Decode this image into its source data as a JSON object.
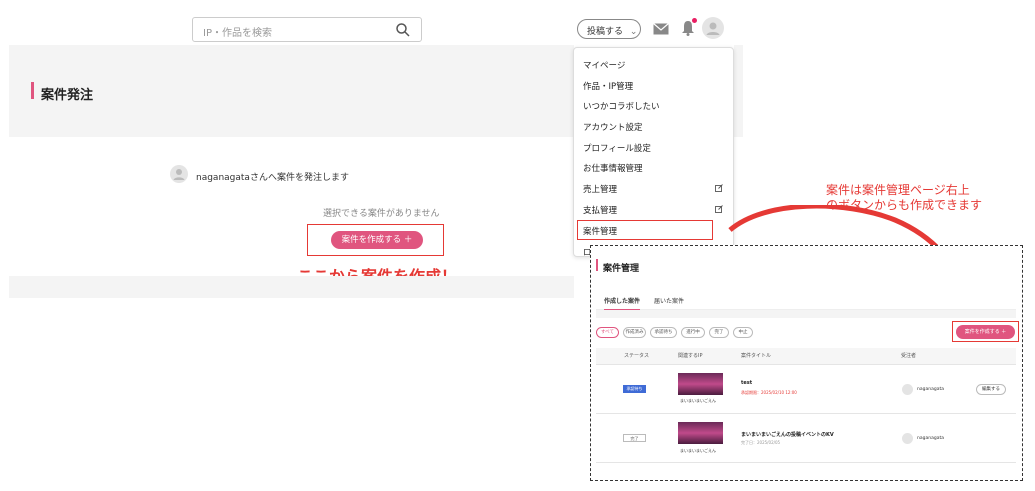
{
  "header": {
    "search_placeholder": "IP・作品を検索",
    "post_button": "投稿する",
    "accent_color": "#e0557f"
  },
  "page": {
    "title": "案件発注",
    "user_message": "naganagataさんへ案件を発注します",
    "empty_message": "選択できる案件がありません",
    "create_button": "案件を作成する ＋",
    "callout_main": "ここから案件を作成！"
  },
  "dropdown": {
    "items": [
      {
        "label": "マイページ"
      },
      {
        "label": "作品・IP管理"
      },
      {
        "label": "いつかコラボしたい"
      },
      {
        "label": "アカウント設定"
      },
      {
        "label": "プロフィール設定"
      },
      {
        "label": "お仕事情報管理"
      },
      {
        "label": "売上管理",
        "external": true
      },
      {
        "label": "支払管理",
        "external": true
      },
      {
        "label": "案件管理"
      },
      {
        "label": "ロ"
      }
    ]
  },
  "callout_side": {
    "line1": "案件は案件管理ページ右上",
    "line2": "のボタンからも作成できます"
  },
  "inset": {
    "title": "案件管理",
    "tabs": [
      "作成した案件",
      "届いた案件"
    ],
    "filters": [
      "すべて",
      "作成済み",
      "承認待ち",
      "進行中",
      "完了",
      "中止"
    ],
    "create_button": "案件を作成する ＋",
    "columns": [
      "ステータス",
      "関連するIP",
      "案件タイトル",
      "受注者"
    ],
    "rows": [
      {
        "status": "承認待ち",
        "ip_caption": "まいまいまいごえん",
        "title": "test",
        "sub": "承認期限：2025/02/10 12:00",
        "user": "naganagata",
        "action": "編集する"
      },
      {
        "status": "完了",
        "ip_caption": "まいまいまいごえん",
        "title": "まいまいまいごえんの投稿イベントのKV",
        "sub": "完了日：2025/02/05",
        "user": "naganagata",
        "action": ""
      }
    ]
  }
}
